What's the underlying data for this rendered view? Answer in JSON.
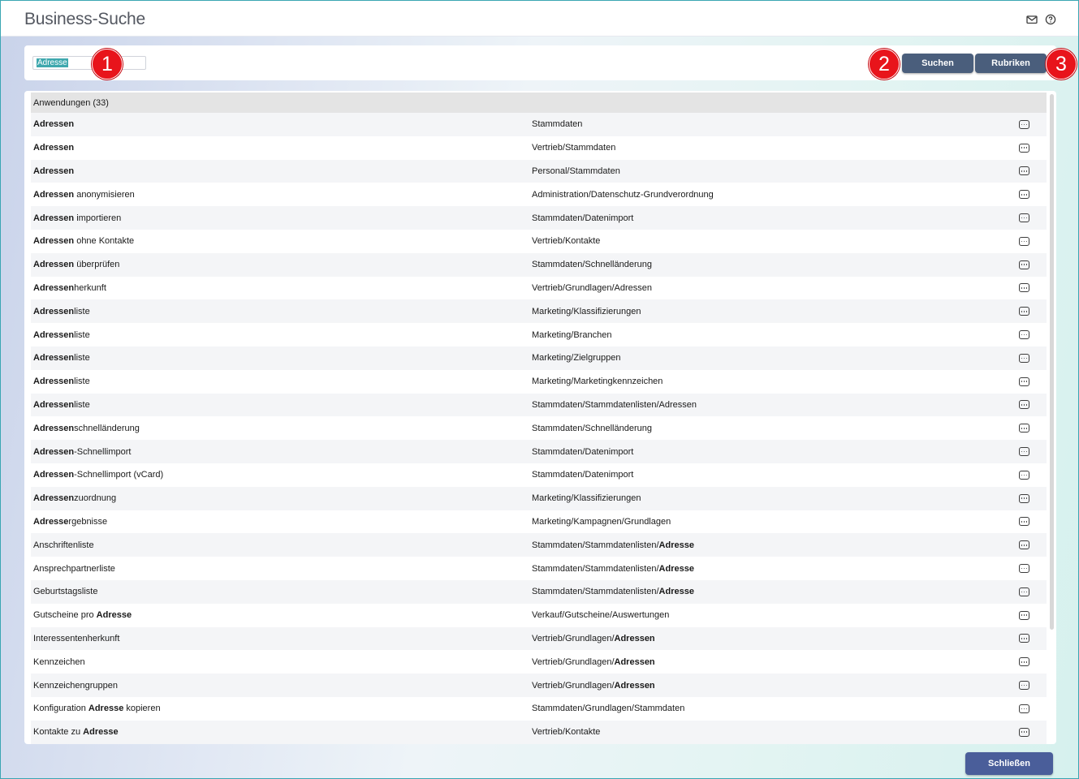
{
  "window": {
    "title": "Business-Suche"
  },
  "search": {
    "value": "Adresse"
  },
  "buttons": {
    "search": "Suchen",
    "rubriken": "Rubriken",
    "close": "Schließen"
  },
  "badges": [
    "1",
    "2",
    "3"
  ],
  "results": {
    "group_label": "Anwendungen (33)",
    "rows": [
      {
        "name": [
          [
            "Adressen",
            true
          ]
        ],
        "path": [
          [
            "Stammdaten",
            false
          ]
        ]
      },
      {
        "name": [
          [
            "Adressen",
            true
          ]
        ],
        "path": [
          [
            "Vertrieb/Stammdaten",
            false
          ]
        ]
      },
      {
        "name": [
          [
            "Adressen",
            true
          ]
        ],
        "path": [
          [
            "Personal/Stammdaten",
            false
          ]
        ]
      },
      {
        "name": [
          [
            "Adressen",
            true
          ],
          [
            " anonymisieren",
            false
          ]
        ],
        "path": [
          [
            "Administration/Datenschutz-Grundverordnung",
            false
          ]
        ]
      },
      {
        "name": [
          [
            "Adressen",
            true
          ],
          [
            " importieren",
            false
          ]
        ],
        "path": [
          [
            "Stammdaten/Datenimport",
            false
          ]
        ]
      },
      {
        "name": [
          [
            "Adressen",
            true
          ],
          [
            " ohne Kontakte",
            false
          ]
        ],
        "path": [
          [
            "Vertrieb/Kontakte",
            false
          ]
        ]
      },
      {
        "name": [
          [
            "Adressen",
            true
          ],
          [
            " überprüfen",
            false
          ]
        ],
        "path": [
          [
            "Stammdaten/Schnelländerung",
            false
          ]
        ]
      },
      {
        "name": [
          [
            "Adressen",
            true
          ],
          [
            "herkunft",
            false
          ]
        ],
        "path": [
          [
            "Vertrieb/Grundlagen/Adressen",
            false
          ]
        ]
      },
      {
        "name": [
          [
            "Adressen",
            true
          ],
          [
            "liste",
            false
          ]
        ],
        "path": [
          [
            "Marketing/Klassifizierungen",
            false
          ]
        ]
      },
      {
        "name": [
          [
            "Adressen",
            true
          ],
          [
            "liste",
            false
          ]
        ],
        "path": [
          [
            "Marketing/Branchen",
            false
          ]
        ]
      },
      {
        "name": [
          [
            "Adressen",
            true
          ],
          [
            "liste",
            false
          ]
        ],
        "path": [
          [
            "Marketing/Zielgruppen",
            false
          ]
        ]
      },
      {
        "name": [
          [
            "Adressen",
            true
          ],
          [
            "liste",
            false
          ]
        ],
        "path": [
          [
            "Marketing/Marketingkennzeichen",
            false
          ]
        ]
      },
      {
        "name": [
          [
            "Adressen",
            true
          ],
          [
            "liste",
            false
          ]
        ],
        "path": [
          [
            "Stammdaten/Stammdatenlisten/Adressen",
            false
          ]
        ]
      },
      {
        "name": [
          [
            "Adressen",
            true
          ],
          [
            "schnelländerung",
            false
          ]
        ],
        "path": [
          [
            "Stammdaten/Schnelländerung",
            false
          ]
        ]
      },
      {
        "name": [
          [
            "Adressen",
            true
          ],
          [
            "-Schnellimport",
            false
          ]
        ],
        "path": [
          [
            "Stammdaten/Datenimport",
            false
          ]
        ]
      },
      {
        "name": [
          [
            "Adressen",
            true
          ],
          [
            "-Schnellimport (vCard)",
            false
          ]
        ],
        "path": [
          [
            "Stammdaten/Datenimport",
            false
          ]
        ]
      },
      {
        "name": [
          [
            "Adressen",
            true
          ],
          [
            "zuordnung",
            false
          ]
        ],
        "path": [
          [
            "Marketing/Klassifizierungen",
            false
          ]
        ]
      },
      {
        "name": [
          [
            "Adresse",
            true
          ],
          [
            "rgebnisse",
            false
          ]
        ],
        "path": [
          [
            "Marketing/Kampagnen/Grundlagen",
            false
          ]
        ]
      },
      {
        "name": [
          [
            "Anschriftenliste",
            false
          ]
        ],
        "path": [
          [
            "Stammdaten/Stammdatenlisten/",
            false
          ],
          [
            "Adresse",
            true
          ]
        ]
      },
      {
        "name": [
          [
            "Ansprechpartnerliste",
            false
          ]
        ],
        "path": [
          [
            "Stammdaten/Stammdatenlisten/",
            false
          ],
          [
            "Adresse",
            true
          ]
        ]
      },
      {
        "name": [
          [
            "Geburtstagsliste",
            false
          ]
        ],
        "path": [
          [
            "Stammdaten/Stammdatenlisten/",
            false
          ],
          [
            "Adresse",
            true
          ]
        ]
      },
      {
        "name": [
          [
            "Gutscheine pro ",
            false
          ],
          [
            "Adresse",
            true
          ]
        ],
        "path": [
          [
            "Verkauf/Gutscheine/Auswertungen",
            false
          ]
        ]
      },
      {
        "name": [
          [
            "Interessentenherkunft",
            false
          ]
        ],
        "path": [
          [
            "Vertrieb/Grundlagen/",
            false
          ],
          [
            "Adressen",
            true
          ]
        ]
      },
      {
        "name": [
          [
            "Kennzeichen",
            false
          ]
        ],
        "path": [
          [
            "Vertrieb/Grundlagen/",
            false
          ],
          [
            "Adressen",
            true
          ]
        ]
      },
      {
        "name": [
          [
            "Kennzeichengruppen",
            false
          ]
        ],
        "path": [
          [
            "Vertrieb/Grundlagen/",
            false
          ],
          [
            "Adressen",
            true
          ]
        ]
      },
      {
        "name": [
          [
            "Konfiguration ",
            false
          ],
          [
            "Adresse",
            true
          ],
          [
            " kopieren",
            false
          ]
        ],
        "path": [
          [
            "Stammdaten/Grundlagen/Stammdaten",
            false
          ]
        ]
      },
      {
        "name": [
          [
            "Kontakte zu ",
            false
          ],
          [
            "Adresse",
            true
          ]
        ],
        "path": [
          [
            "Vertrieb/Kontakte",
            false
          ]
        ]
      }
    ]
  },
  "icons": {
    "mail": "mail-icon",
    "help": "help-icon",
    "more": "more-icon"
  },
  "colors": {
    "button": "#4a5e7c",
    "close_button": "#4a5e9a",
    "badge": "#e8141b",
    "highlight": "#3fa8ae"
  }
}
